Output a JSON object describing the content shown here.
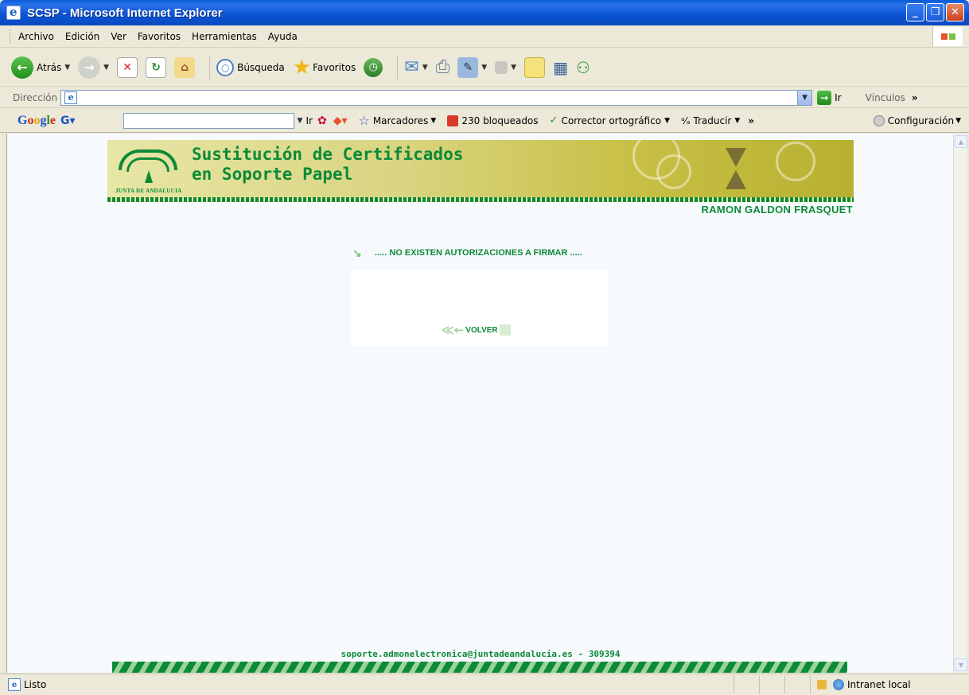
{
  "window": {
    "title": "SCSP - Microsoft Internet Explorer",
    "min_glyph": "_",
    "max_glyph": "❐",
    "close_glyph": "✕"
  },
  "menubar": {
    "items": [
      "Archivo",
      "Edición",
      "Ver",
      "Favoritos",
      "Herramientas",
      "Ayuda"
    ]
  },
  "toolbar": {
    "back_label": "Atrás",
    "search_label": "Búsqueda",
    "favorites_label": "Favoritos"
  },
  "address": {
    "label": "Dirección",
    "value": "",
    "go_label": "Ir",
    "links_label": "Vínculos"
  },
  "googlebar": {
    "logo": "Google",
    "go_label": "Ir",
    "bookmarks_label": "Marcadores",
    "blocked_label": "230 bloqueados",
    "spell_label": "Corrector ortográfico",
    "translate_label": "Traducir",
    "more_label": "»",
    "settings_label": "Configuración"
  },
  "page": {
    "banner_title_line1": "Sustitución de Certificados",
    "banner_title_line2": "en Soporte Papel",
    "logo_text": "JUNTA DE ANDALUCIA",
    "user_name": "RAMON GALDON FRASQUET",
    "message": "..... NO EXISTEN AUTORIZACIONES A FIRMAR .....",
    "back_button": "VOLVER",
    "footer_email": "soporte.admonelectronica@juntadeandalucia.es - 309394"
  },
  "statusbar": {
    "status": "Listo",
    "zone": "Intranet local"
  },
  "colors": {
    "brand_green": "#0c8a39",
    "xp_blue": "#0a5bd8"
  }
}
